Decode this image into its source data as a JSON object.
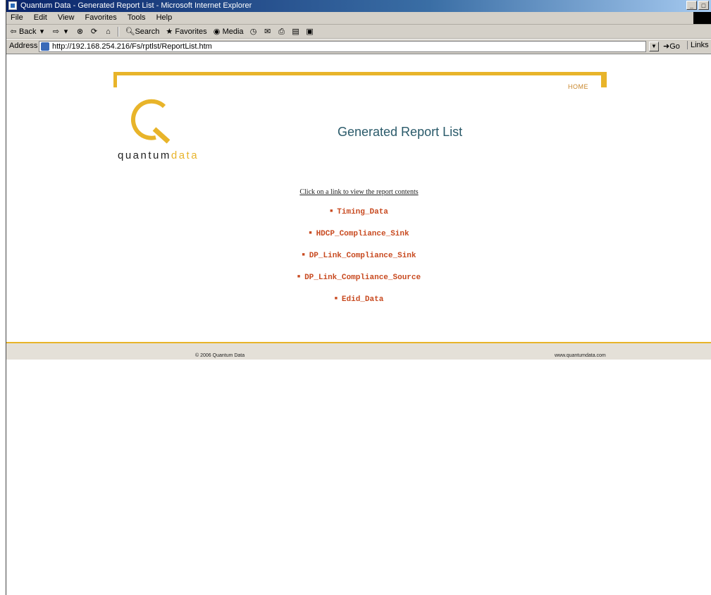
{
  "window": {
    "title": "Quantum Data - Generated Report List - Microsoft Internet Explorer",
    "controls": [
      "_",
      "□"
    ]
  },
  "menu": [
    "File",
    "Edit",
    "View",
    "Favorites",
    "Tools",
    "Help"
  ],
  "toolbar": {
    "back_label": "Back",
    "search_label": "Search",
    "favorites_label": "Favorites",
    "media_label": "Media"
  },
  "address": {
    "label": "Address",
    "url": "http://192.168.254.216/Fs/rptlst/ReportList.htm",
    "go_label": "Go",
    "links_label": "Links"
  },
  "page": {
    "home_link": "HOME",
    "logo_main": "quantum",
    "logo_accent": "data",
    "title": "Generated Report List",
    "instruction": "Click on a link to view the report contents",
    "reports": [
      "Timing_Data",
      "HDCP_Compliance_Sink",
      "DP_Link_Compliance_Sink",
      "DP_Link_Compliance_Source",
      "Edid_Data"
    ],
    "footer_left": "© 2006 Quantum Data",
    "footer_right": "www.quantumdata.com"
  },
  "colors": {
    "accent_gold": "#e8b42a",
    "link_red": "#c84a20",
    "title_teal": "#2a5a6a"
  }
}
